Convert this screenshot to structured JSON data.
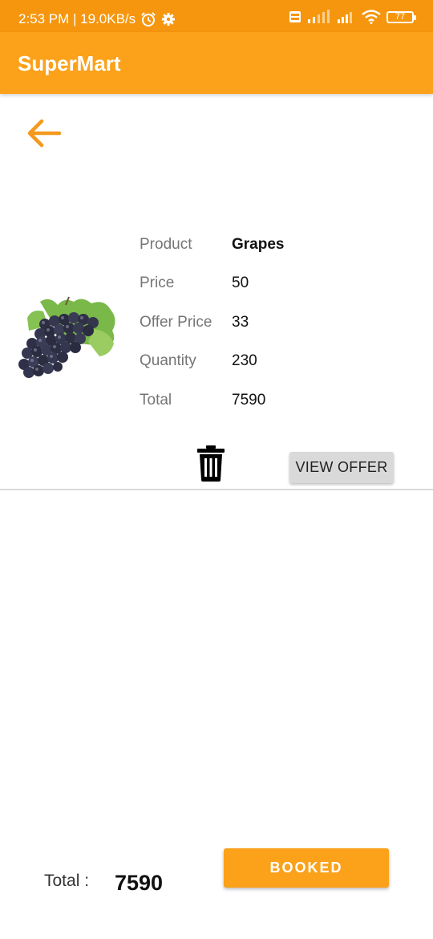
{
  "status_bar": {
    "time_speed": "2:53 PM | 19.0KB/s",
    "battery": "77",
    "icons": [
      "alarm-icon",
      "settings-icon",
      "volte-icon",
      "signal-icon",
      "signal-icon-2",
      "wifi-icon",
      "battery-icon"
    ]
  },
  "app_bar": {
    "title": "SuperMart"
  },
  "colors": {
    "status_bar": "#F6960E",
    "accent": "#FBA11A",
    "button_gray": "#D9D9D9"
  },
  "product": {
    "rows": [
      {
        "label": "Product",
        "value": "Grapes"
      },
      {
        "label": "Price",
        "value": "50"
      },
      {
        "label": "Offer Price",
        "value": "33"
      },
      {
        "label": "Quantity",
        "value": "230"
      },
      {
        "label": "Total",
        "value": "7590"
      }
    ],
    "view_offer_label": "VIEW OFFER"
  },
  "footer": {
    "total_label": "Total :",
    "total_value": "7590",
    "booked_label": "BOOKED"
  }
}
